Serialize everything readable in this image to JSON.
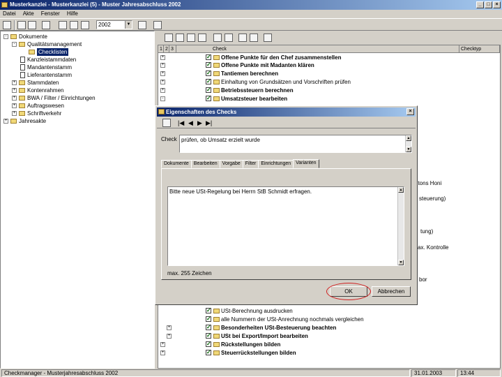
{
  "app": {
    "title": "Musterkanzlei - Musterkanzlei (5) - Muster Jahresabschluss 2002"
  },
  "menu": [
    "Datei",
    "Akte",
    "Fenster",
    "Hilfe"
  ],
  "toolbar": {
    "year_value": "2002"
  },
  "tree": {
    "items": [
      "Dokumente",
      "Qualitätsmanagement",
      "Checklisten",
      "Kanzleistammdaten",
      "Mandantenstamm",
      "Lieferantenstamm",
      "Stammdaten",
      "Kontenrahmen",
      "BWA / Filter / Einrichtungen",
      "Auftragswesen",
      "Schriftverkehr",
      "Jahresakte"
    ]
  },
  "grid": {
    "columns": [
      "1",
      "2",
      "3",
      "Check",
      "Checktyp"
    ],
    "top_rows": [
      "Offene Punkte für den Chef zusammenstellen",
      "Offene Punkte mit Madanten klären",
      "Tantiemen berechnen",
      "Einhaltung von Grundsätzen und Vorschriften prüfen",
      "Betriebssteuern berechnen",
      "Umsatzsteuer bearbeiten"
    ],
    "bottom_rows": [
      "USt-Berechnung ausdrucken",
      "alle Nummern der USt-Anrechnung nochmals vergleichen",
      "Besonderheiten USt-Besteuerung beachten",
      "USt bei Export/Import bearbeiten",
      "Rückstellungen bilden",
      "Steuerrückstellungen bilden"
    ],
    "side_fragments": [
      "ntons Honi",
      "steuerung)",
      "tung)",
      "ax. Kontrolle",
      "bor"
    ]
  },
  "dialog": {
    "title": "Eigenschaften des Checks",
    "check_label": "Check",
    "check_value": "prüfen, ob Umsatz erzielt wurde",
    "tabs": [
      "Dokumente",
      "Bearbeiten",
      "Vorgabe",
      "Filter",
      "Einrichtungen",
      "Varianten"
    ],
    "note_text": "Bitte neue USt-Regelung bei Herrn StB Schmidt erfragen.",
    "char_limit": "max. 255 Zeichen",
    "ok_label": "OK",
    "cancel_label": "Abbrechen"
  },
  "statusbar": {
    "left": "Checkmanager - Musterjahresabschluss 2002",
    "date": "31.01.2003",
    "time": "13:44"
  }
}
